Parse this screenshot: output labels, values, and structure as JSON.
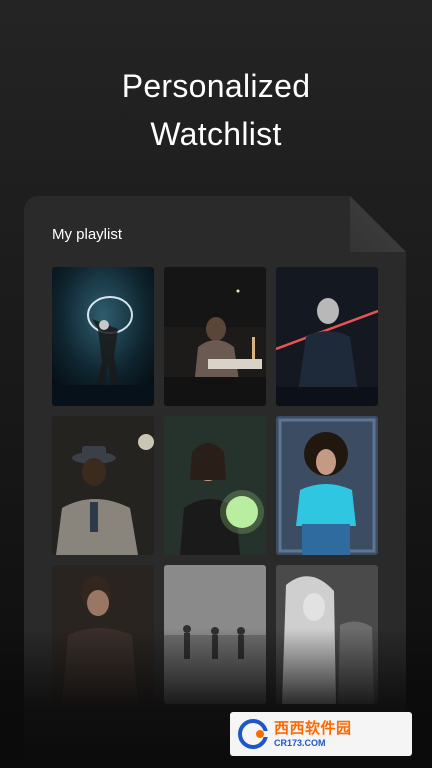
{
  "headline": {
    "line1": "Personalized",
    "line2": "Watchlist"
  },
  "playlist": {
    "title": "My playlist",
    "tiles": [
      {
        "name": "playlist-tile-1"
      },
      {
        "name": "playlist-tile-2"
      },
      {
        "name": "playlist-tile-3"
      },
      {
        "name": "playlist-tile-4"
      },
      {
        "name": "playlist-tile-5"
      },
      {
        "name": "playlist-tile-6"
      },
      {
        "name": "playlist-tile-7"
      },
      {
        "name": "playlist-tile-8"
      },
      {
        "name": "playlist-tile-9"
      }
    ]
  },
  "watermark": {
    "brand": "西西软件园",
    "url": "CR173.COM"
  },
  "colors": {
    "background": "#1a1a1a",
    "card": "#2a2a2a",
    "text": "#ffffff",
    "watermark_orange": "#ff6a00",
    "watermark_blue": "#1d57c7"
  }
}
